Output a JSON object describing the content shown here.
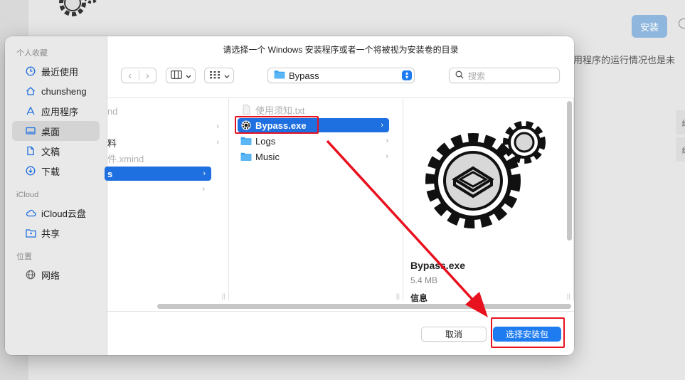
{
  "background": {
    "install_label": "安装",
    "description_fragment": "用程序的运行情况也是未",
    "side_tabs": [
      "纟",
      "纟"
    ]
  },
  "dialog": {
    "title": "请选择一个 Windows 安装程序或者一个将被视为安装卷的目录",
    "sidebar": {
      "sections": [
        {
          "label": "个人收藏",
          "items": [
            {
              "label": "最近使用",
              "icon": "clock-icon"
            },
            {
              "label": "chunsheng",
              "icon": "home-icon"
            },
            {
              "label": "应用程序",
              "icon": "apps-icon"
            },
            {
              "label": "桌面",
              "icon": "desktop-icon",
              "selected": true
            },
            {
              "label": "文稿",
              "icon": "document-icon"
            },
            {
              "label": "下载",
              "icon": "download-icon"
            }
          ]
        },
        {
          "label": "iCloud",
          "items": [
            {
              "label": "iCloud云盘",
              "icon": "cloud-icon"
            },
            {
              "label": "共享",
              "icon": "shared-folder-icon"
            }
          ]
        },
        {
          "label": "位置",
          "items": [
            {
              "label": "网络",
              "icon": "globe-icon"
            }
          ]
        }
      ]
    },
    "toolbar": {
      "back_glyph": "‹",
      "forward_glyph": "›",
      "path_label": "Bypass",
      "search_placeholder": "搜索"
    },
    "columns": {
      "col1": [
        {
          "label": "nd",
          "dim": true
        },
        {
          "label": "",
          "has_children": true
        },
        {
          "label": "料",
          "has_children": true
        },
        {
          "label": "件.xmind",
          "dim": true
        },
        {
          "label": "s",
          "has_children": true,
          "selected": true
        },
        {
          "label": "",
          "has_children": true
        }
      ],
      "col2": [
        {
          "label": "使用须知.txt",
          "icon": "text-file-icon",
          "dim": true
        },
        {
          "label": "Bypass.exe",
          "icon": "gear-app-icon",
          "selected": true
        },
        {
          "label": "Logs",
          "icon": "folder-icon",
          "has_children": true
        },
        {
          "label": "Music",
          "icon": "folder-icon",
          "has_children": true
        }
      ]
    },
    "preview": {
      "name": "Bypass.exe",
      "size": "5.4 MB",
      "info_label": "信息"
    },
    "buttons": {
      "cancel": "取消",
      "choose": "选择安装包"
    }
  },
  "colors": {
    "accent": "#1e7cf0",
    "selection": "#1e6fe0",
    "annotation_red": "#e8111f"
  }
}
